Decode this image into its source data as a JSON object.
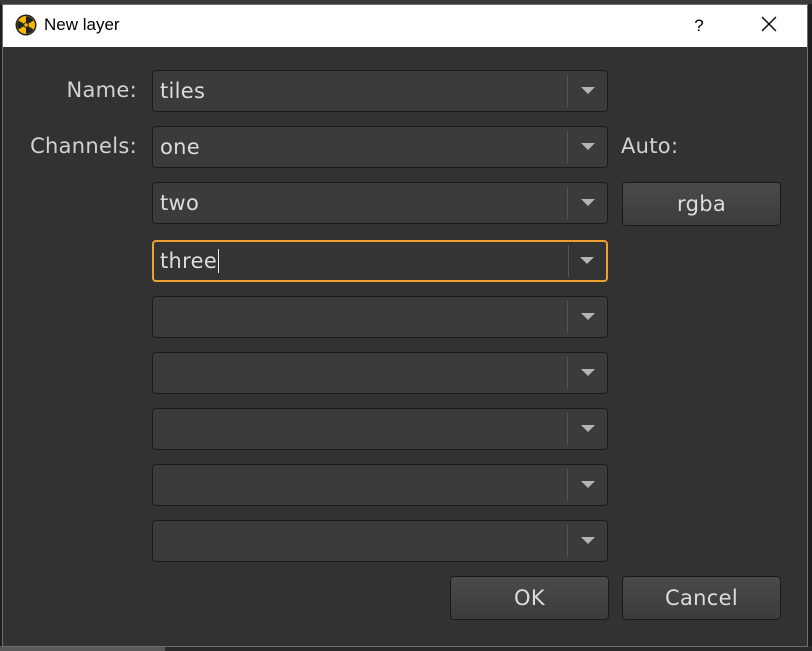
{
  "window": {
    "title": "New layer",
    "help_label": "?",
    "icons": {
      "app": "nuke-app-icon",
      "close": "close-icon",
      "dropdown": "chevron-down-icon"
    }
  },
  "form": {
    "name_label": "Name:",
    "name_value": "tiles",
    "channels_label": "Channels:",
    "auto_label": "Auto:",
    "auto_button_label": "rgba",
    "channels": [
      "one",
      "two",
      "three",
      "",
      "",
      "",
      "",
      ""
    ]
  },
  "buttons": {
    "ok_label": "OK",
    "cancel_label": "Cancel"
  },
  "colors": {
    "dialog_background": "#323232",
    "focus_accent": "#f0a030",
    "field_background": "#3b3b3b",
    "text": "#dcdcdc"
  }
}
